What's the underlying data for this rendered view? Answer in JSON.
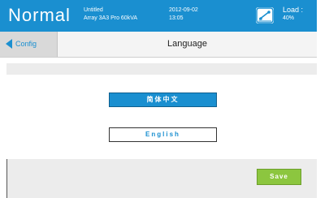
{
  "header": {
    "mode": "Normal",
    "device_line1": "Untitled",
    "device_line2": "Array 3A3 Pro 60kVA",
    "date": "2012-09-02",
    "time": "13:05",
    "load_label": "Load :",
    "load_value": "40%",
    "load_icon": "load-meter-icon",
    "color": "#1a8fd0"
  },
  "titlebar": {
    "back_label": "Config",
    "back_icon": "back-arrow-icon",
    "title": "Language"
  },
  "languages": [
    {
      "label": "简体中文",
      "selected": true
    },
    {
      "label": "English",
      "selected": false
    }
  ],
  "footer": {
    "save_label": "Save",
    "save_color": "#8cc63f"
  }
}
